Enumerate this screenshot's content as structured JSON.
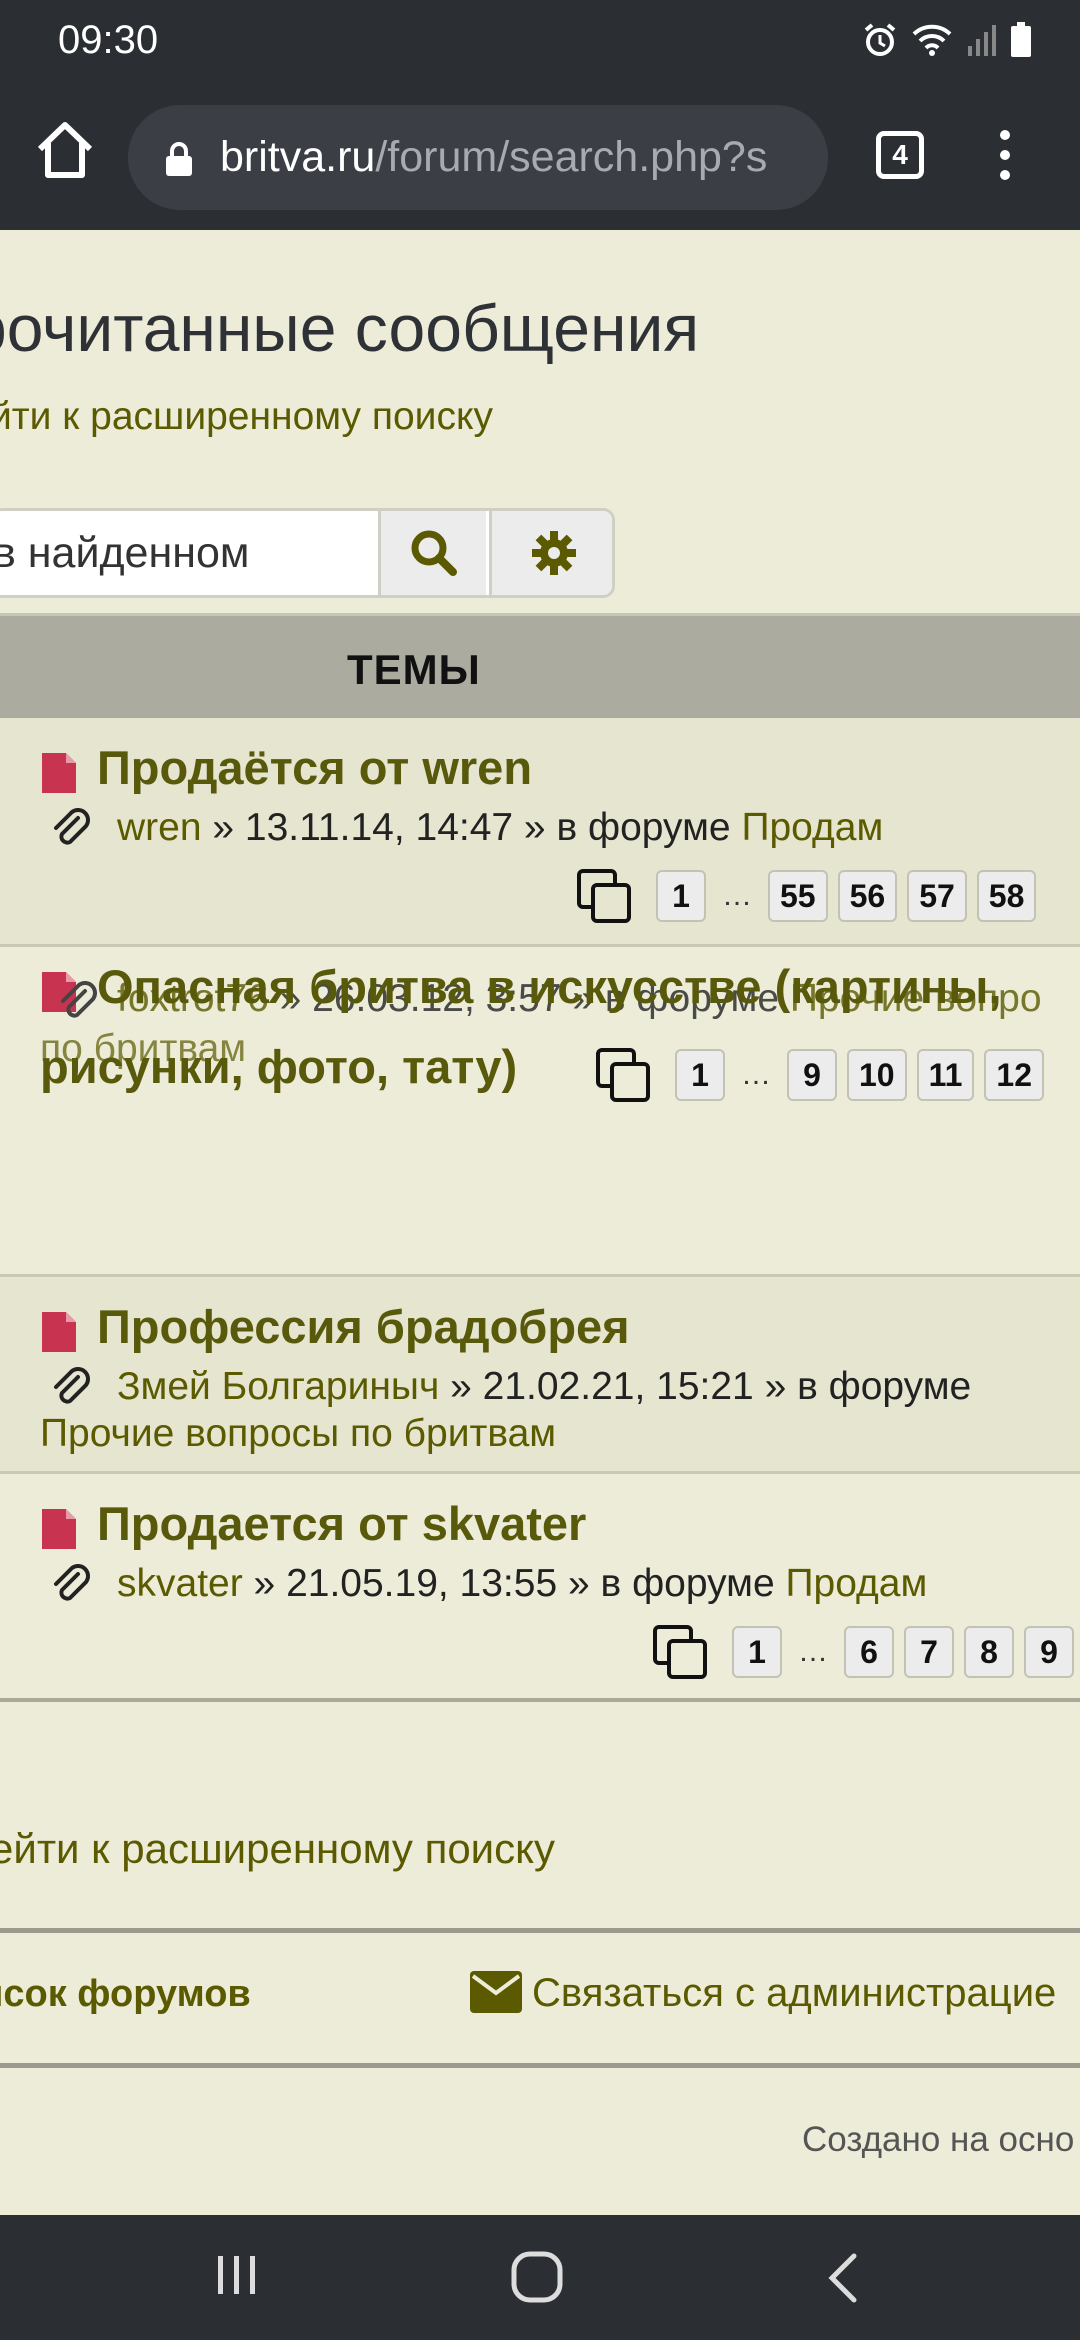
{
  "status": {
    "time": "09:30"
  },
  "browser": {
    "url_domain": "britva.ru",
    "url_path": "/forum/search.php?s",
    "tab_count": "4"
  },
  "page": {
    "title": "рочитанные сообщения",
    "advanced_search_link": "йти к расширенному поиску",
    "search_placeholder": "в найденном"
  },
  "topics_header": "ТЕМЫ",
  "topics": [
    {
      "title": "Продаётся от wren",
      "author": "wren",
      "date": "» 13.11.14, 14:47 » в форуме ",
      "forum": "Продам",
      "pages": [
        "1",
        "…",
        "55",
        "56",
        "57",
        "58"
      ]
    },
    {
      "title_line1": "Опасная бритва в искусстве (картины,",
      "title_line2": "рисунки, фото, тату)",
      "author": "foxtrot76",
      "date": "» 26.03.12, 3:57 » в форуме ",
      "forum": "Прочие вопро",
      "forum_cont": "по бритвам",
      "pages": [
        "1",
        "…",
        "9",
        "10",
        "11",
        "12"
      ]
    },
    {
      "title": "Профессия брадобрея",
      "author": "Змей Болгариныч",
      "date": "» 21.02.21, 15:21 » в форуме",
      "forum": "Прочие вопросы по бритвам"
    },
    {
      "title": "Продается от skvater",
      "author": "skvater",
      "date": "» 21.05.19, 13:55 » в форуме ",
      "forum": "Продам",
      "pages": [
        "1",
        "…",
        "6",
        "7",
        "8",
        "9"
      ]
    }
  ],
  "footer": {
    "advanced_search_link": "ейти к расширенному поиску",
    "forums_link": "исок форумов",
    "contact_link": "Связаться с администрацие",
    "created_text": "Создано на осно"
  },
  "colors": {
    "accent": "#5b5a00",
    "topic_icon": "#c8344f",
    "header_bg": "#ababa0",
    "page_bg": "#ececd8"
  }
}
